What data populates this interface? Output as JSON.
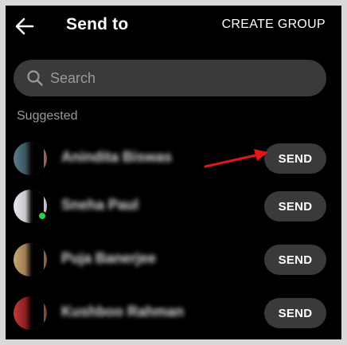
{
  "header": {
    "back_icon": "arrow-left-icon",
    "title": "Send to",
    "create_group_label": "CREATE GROUP"
  },
  "search": {
    "icon": "search-icon",
    "placeholder": "Search",
    "value": ""
  },
  "section": {
    "label": "Suggested"
  },
  "contacts": [
    {
      "name": "Anindita Biswas",
      "send_label": "SEND",
      "online": false
    },
    {
      "name": "Sneha Paul",
      "send_label": "SEND",
      "online": true
    },
    {
      "name": "Puja Banerjee",
      "send_label": "SEND",
      "online": false
    },
    {
      "name": "Kushboo Rahman",
      "send_label": "SEND",
      "online": false
    }
  ],
  "annotation": {
    "arrow_color": "#e01818",
    "target": "first SEND button"
  },
  "colors": {
    "background": "#000000",
    "pill": "#3a3a3c",
    "text": "#ffffff",
    "muted": "#9a9a9a",
    "online": "#31cc46"
  }
}
